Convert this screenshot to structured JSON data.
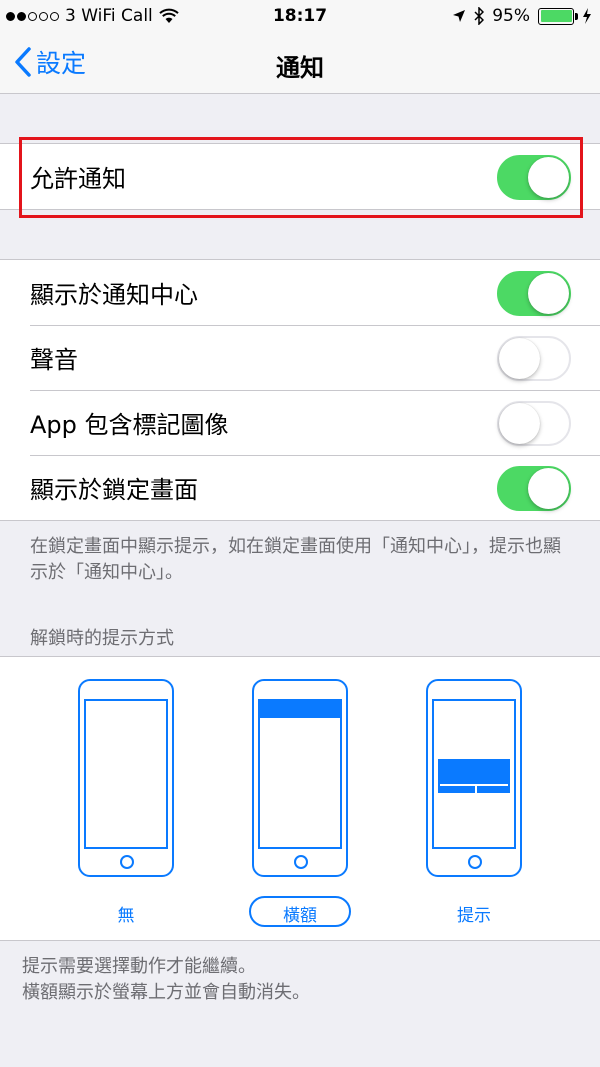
{
  "status_bar": {
    "carrier": "3 WiFi Call",
    "time": "18:17",
    "battery_percent": "95%",
    "signal_bars_filled": 2,
    "signal_bars_total": 5
  },
  "nav": {
    "back_label": "設定",
    "title": "通知"
  },
  "allow_notifications": {
    "label": "允許通知",
    "on": true
  },
  "settings": [
    {
      "label": "顯示於通知中心",
      "on": true
    },
    {
      "label": "聲音",
      "on": false
    },
    {
      "label": "App 包含標記圖像",
      "on": false
    },
    {
      "label": "顯示於鎖定畫面",
      "on": true
    }
  ],
  "lock_screen_footnote": "在鎖定畫面中顯示提示，如在鎖定畫面使用「通知中心」，提示也顯示於「通知中心」。",
  "alert_style": {
    "header": "解鎖時的提示方式",
    "options": [
      {
        "label": "無",
        "selected": false
      },
      {
        "label": "橫額",
        "selected": true
      },
      {
        "label": "提示",
        "selected": false
      }
    ],
    "footnote_line1": "提示需要選擇動作才能繼續。",
    "footnote_line2": "橫額顯示於螢幕上方並會自動消失。"
  },
  "colors": {
    "accent": "#0a7aff",
    "toggle_on": "#4cd964",
    "highlight": "#e3141b"
  }
}
